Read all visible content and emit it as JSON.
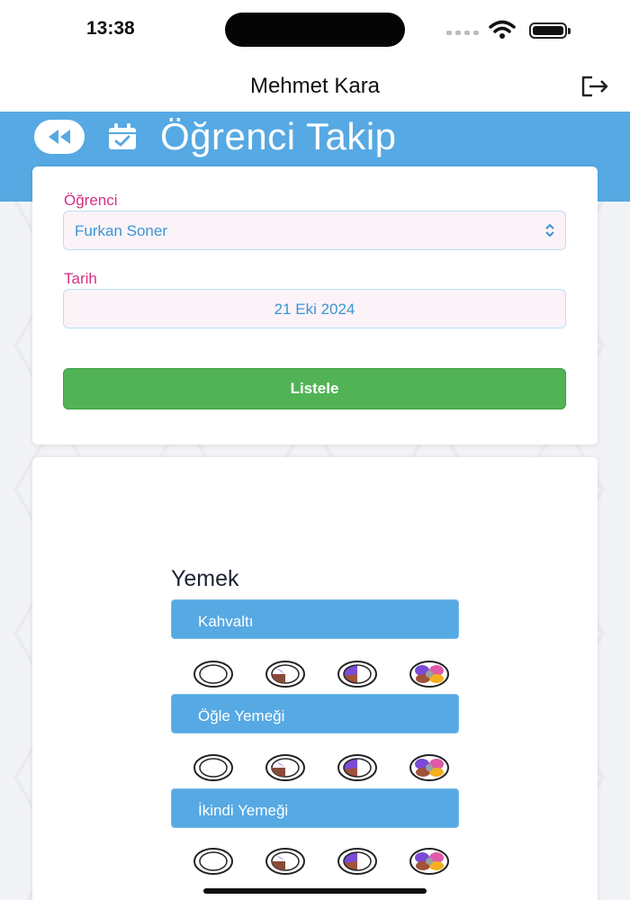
{
  "status_bar": {
    "time": "13:38"
  },
  "nav": {
    "user_name": "Mehmet Kara"
  },
  "header": {
    "title": "Öğrenci Takip"
  },
  "form": {
    "student_label": "Öğrenci",
    "student_value": "Furkan Soner",
    "date_label": "Tarih",
    "date_value": "21 Eki 2024",
    "submit_label": "Listele"
  },
  "food_section": {
    "title": "Yemek",
    "meals": [
      {
        "label": "Kahvaltı"
      },
      {
        "label": "Öğle Yemeği"
      },
      {
        "label": "İkindi Yemeği"
      }
    ],
    "portion_levels": [
      "empty-plate",
      "quarter-plate",
      "half-plate",
      "full-plate"
    ]
  },
  "colors": {
    "accent_blue": "#56a9e3",
    "label_pink": "#d62f86",
    "value_blue": "#3a95d6",
    "button_green": "#52b356"
  },
  "icons": [
    "wifi-icon",
    "battery-icon",
    "logout-icon",
    "rewind-icon",
    "calendar-check-icon",
    "select-arrows-icon"
  ]
}
